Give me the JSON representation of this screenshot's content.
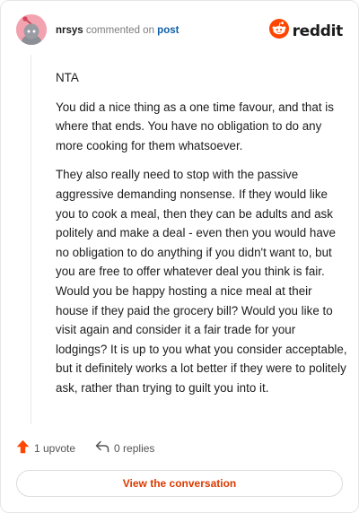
{
  "header": {
    "username": "nrsys",
    "verb": "commented on",
    "post_link": "post",
    "brand": "reddit",
    "avatar_icon": "snoo-avatar-icon",
    "brand_icon": "reddit-alien-icon"
  },
  "comment": {
    "paragraphs": [
      "NTA",
      "You did a nice thing as a one time favour, and that is where that ends. You have no obligation to do any more cooking for them whatsoever.",
      "They also really need to stop with the passive aggressive demanding nonsense. If they would like you to cook a meal, then they can be adults and ask politely and make a deal - even then you would have no obligation to do anything if you didn't want to, but you are free to offer whatever deal you think is fair. Would you be happy hosting a nice meal at their house if they paid the grocery bill? Would you like to visit again and consider it a fair trade for your lodgings? It is up to you what you consider acceptable, but it definitely works a lot better if they were to politely ask, rather than trying to guilt you into it."
    ]
  },
  "actions": {
    "upvotes": "1 upvote",
    "replies": "0 replies",
    "upvote_icon": "upvote-arrow-icon",
    "reply_icon": "reply-arrow-icon"
  },
  "cta": {
    "label": "View the conversation"
  },
  "colors": {
    "accent": "#d93a00",
    "reddit_orange": "#ff4500",
    "link": "#0e5fa8",
    "avatar_bg": "#f3a3b0"
  }
}
